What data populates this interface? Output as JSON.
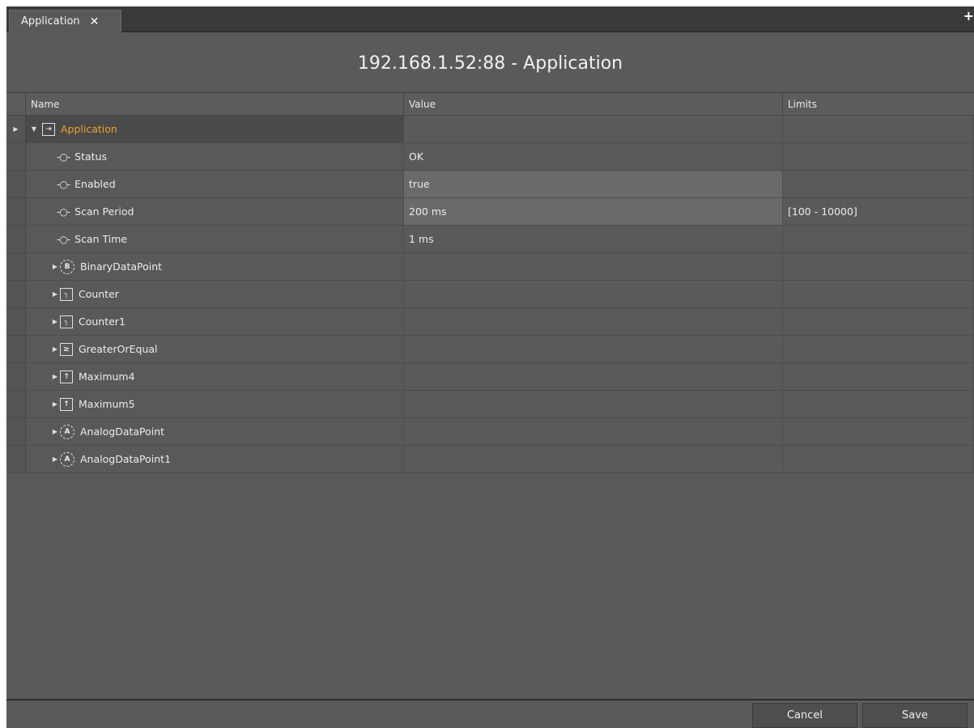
{
  "tabs": [
    {
      "label": "Application",
      "close_icon": "close-icon"
    }
  ],
  "tabbar": {
    "add_icon": "plus-icon"
  },
  "title": "192.168.1.52:88 - Application",
  "columns": {
    "name": "Name",
    "value": "Value",
    "limits": "Limits"
  },
  "root": {
    "name": "Application",
    "icon": "application-icon",
    "color": "#f0a030"
  },
  "properties": [
    {
      "name": "Status",
      "value": "OK",
      "limits": ""
    },
    {
      "name": "Enabled",
      "value": "true",
      "limits": ""
    },
    {
      "name": "Scan Period",
      "value": "200 ms",
      "limits": "[100 - 10000]"
    },
    {
      "name": "Scan Time",
      "value": "1 ms",
      "limits": ""
    }
  ],
  "children": [
    {
      "name": "BinaryDataPoint",
      "icon": "binary-datapoint-icon",
      "glyph": "B"
    },
    {
      "name": "Counter",
      "icon": "counter-icon",
      "glyph": "┐"
    },
    {
      "name": "Counter1",
      "icon": "counter-icon",
      "glyph": "┐"
    },
    {
      "name": "GreaterOrEqual",
      "icon": "greater-or-equal-icon",
      "glyph": "≥"
    },
    {
      "name": "Maximum4",
      "icon": "maximum-icon",
      "glyph": "↑"
    },
    {
      "name": "Maximum5",
      "icon": "maximum-icon",
      "glyph": "↑"
    },
    {
      "name": "AnalogDataPoint",
      "icon": "analog-datapoint-icon",
      "glyph": "A"
    },
    {
      "name": "AnalogDataPoint1",
      "icon": "analog-datapoint-icon",
      "glyph": "A"
    }
  ],
  "buttons": {
    "cancel": "Cancel",
    "save": "Save"
  }
}
